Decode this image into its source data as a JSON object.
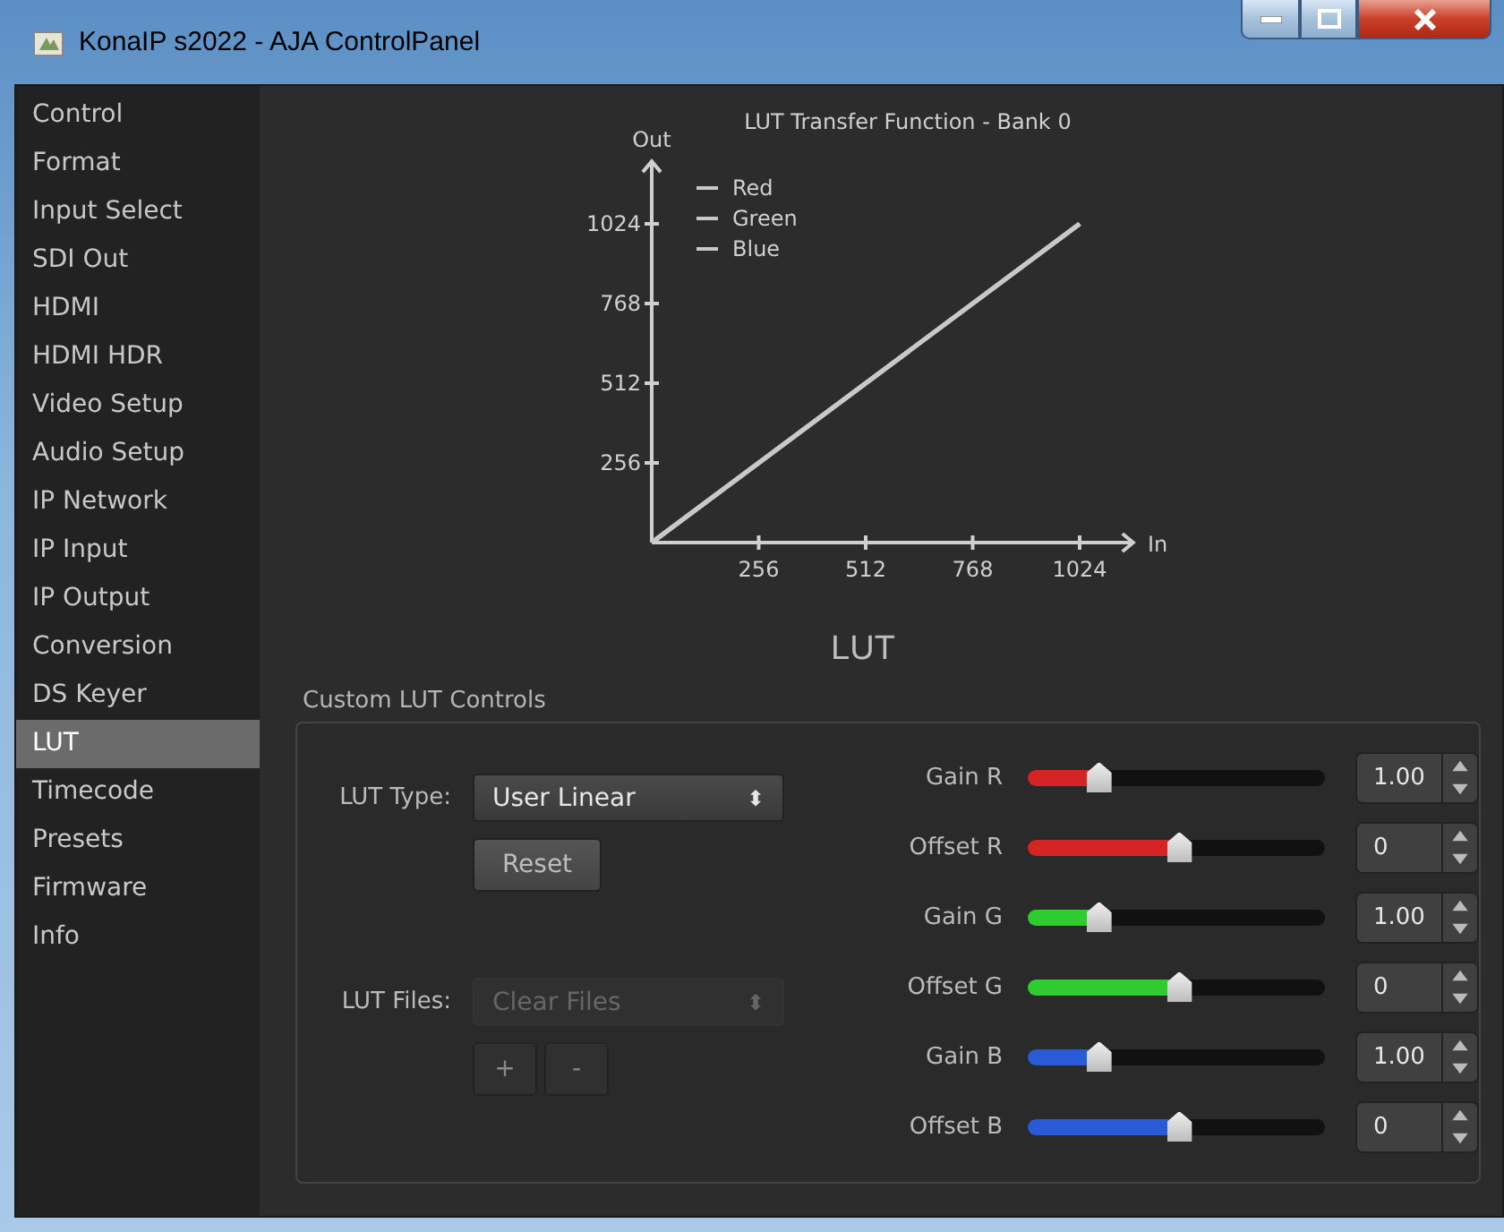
{
  "window": {
    "title": "KonaIP s2022 - AJA ControlPanel"
  },
  "sidebar": {
    "items": [
      {
        "label": "Control",
        "selected": false
      },
      {
        "label": "Format",
        "selected": false
      },
      {
        "label": "Input Select",
        "selected": false
      },
      {
        "label": "SDI Out",
        "selected": false
      },
      {
        "label": "HDMI",
        "selected": false
      },
      {
        "label": "HDMI HDR",
        "selected": false
      },
      {
        "label": "Video Setup",
        "selected": false
      },
      {
        "label": "Audio Setup",
        "selected": false
      },
      {
        "label": "IP Network",
        "selected": false
      },
      {
        "label": "IP Input",
        "selected": false
      },
      {
        "label": "IP Output",
        "selected": false
      },
      {
        "label": "Conversion",
        "selected": false
      },
      {
        "label": "DS Keyer",
        "selected": false
      },
      {
        "label": "LUT",
        "selected": true
      },
      {
        "label": "Timecode",
        "selected": false
      },
      {
        "label": "Presets",
        "selected": false
      },
      {
        "label": "Firmware",
        "selected": false
      },
      {
        "label": "Info",
        "selected": false
      }
    ]
  },
  "chart": {
    "chart_data": {
      "type": "line",
      "title": "LUT Transfer Function - Bank 0",
      "xlabel": "In",
      "ylabel": "Out",
      "x": [
        0,
        1024
      ],
      "xlim": [
        0,
        1152
      ],
      "ylim": [
        0,
        1225
      ],
      "legend": "upper-left",
      "xticks": [
        256,
        512,
        768,
        1024
      ],
      "yticks": [
        256,
        512,
        768,
        1024
      ],
      "series": [
        {
          "name": "Red",
          "color": "#c8c8c8",
          "values": [
            0,
            1024
          ]
        },
        {
          "name": "Green",
          "color": "#c8c8c8",
          "values": [
            0,
            1024
          ]
        },
        {
          "name": "Blue",
          "color": "#c8c8c8",
          "values": [
            0,
            1024
          ]
        }
      ]
    }
  },
  "section_title": "LUT",
  "custom_lut_controls": {
    "title": "Custom LUT Controls",
    "lut_type": {
      "label": "LUT Type:",
      "value": "User Linear",
      "arrows": "⬍"
    },
    "reset_button": "Reset",
    "lut_files": {
      "label": "LUT Files:",
      "value": "Clear Files",
      "disabled": true,
      "arrows": "⬍"
    },
    "add_button": "+",
    "remove_button": "-",
    "sliders": [
      {
        "label": "Gain R",
        "color": "#d42424",
        "level": 0.24,
        "reading": "1.00"
      },
      {
        "label": "Offset R",
        "color": "#d42424",
        "level": 0.51,
        "reading": "0"
      },
      {
        "label": "Gain G",
        "color": "#2ecc2e",
        "level": 0.24,
        "reading": "1.00"
      },
      {
        "label": "Offset G",
        "color": "#2ecc2e",
        "level": 0.51,
        "reading": "0"
      },
      {
        "label": "Gain B",
        "color": "#2a5bd6",
        "level": 0.24,
        "reading": "1.00"
      },
      {
        "label": "Offset B",
        "color": "#2a5bd6",
        "level": 0.51,
        "reading": "0"
      }
    ]
  }
}
